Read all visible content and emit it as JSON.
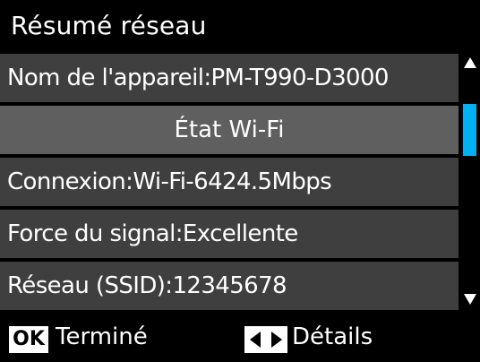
{
  "header": {
    "title": "Résumé réseau"
  },
  "list": {
    "rows": [
      {
        "text": "Nom de l'appareil:PM-T990-D3000"
      },
      {
        "text": "État Wi-Fi"
      },
      {
        "text": "Connexion:Wi-Fi-6424.5Mbps"
      },
      {
        "text": "Force du signal:Excellente"
      },
      {
        "text": "Réseau (SSID):12345678"
      }
    ]
  },
  "footer": {
    "ok_key": "OK",
    "ok_label": "Terminé",
    "details_label": "Détails"
  },
  "colors": {
    "background": "#000000",
    "row": "#3f3f3f",
    "section_header": "#5f5f5f",
    "scroll_thumb": "#00b0f0"
  },
  "icons": {
    "scroll_up": "triangle-up-icon",
    "scroll_down": "triangle-down-icon",
    "left_key": "triangle-left-icon",
    "right_key": "triangle-right-icon"
  }
}
